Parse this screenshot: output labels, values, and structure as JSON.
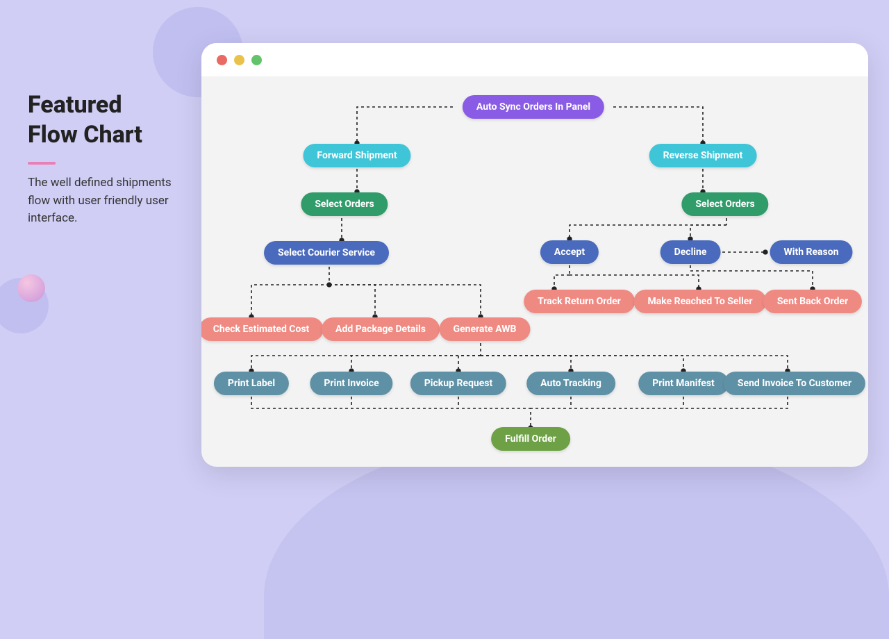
{
  "sidebar": {
    "title_line1": "Featured",
    "title_line2": "Flow Chart",
    "description": "The well defined shipments flow with user friendly user interface."
  },
  "nodes": {
    "auto_sync": "Auto Sync Orders In Panel",
    "forward_shipment": "Forward Shipment",
    "reverse_shipment": "Reverse Shipment",
    "select_orders_fwd": "Select Orders",
    "select_orders_rev": "Select Orders",
    "select_courier": "Select Courier Service",
    "accept": "Accept",
    "decline": "Decline",
    "with_reason": "With Reason",
    "track_return": "Track Return Order",
    "make_reached": "Make Reached To Seller",
    "sent_back": "Sent Back Order",
    "check_cost": "Check Estimated Cost",
    "add_package": "Add Package Details",
    "generate_awb": "Generate AWB",
    "print_label": "Print Label",
    "print_invoice": "Print Invoice",
    "pickup_request": "Pickup Request",
    "auto_tracking": "Auto Tracking",
    "print_manifest": "Print Manifest",
    "send_invoice": "Send Invoice To Customer",
    "fulfill_order": "Fulfill Order"
  },
  "colors": {
    "purple": "#8a5ce6",
    "teal": "#3fc5d8",
    "green": "#2f9c6a",
    "blue": "#4a6bbd",
    "peach": "#ef8a82",
    "steel": "#5f91a6",
    "olive": "#6ea046"
  }
}
